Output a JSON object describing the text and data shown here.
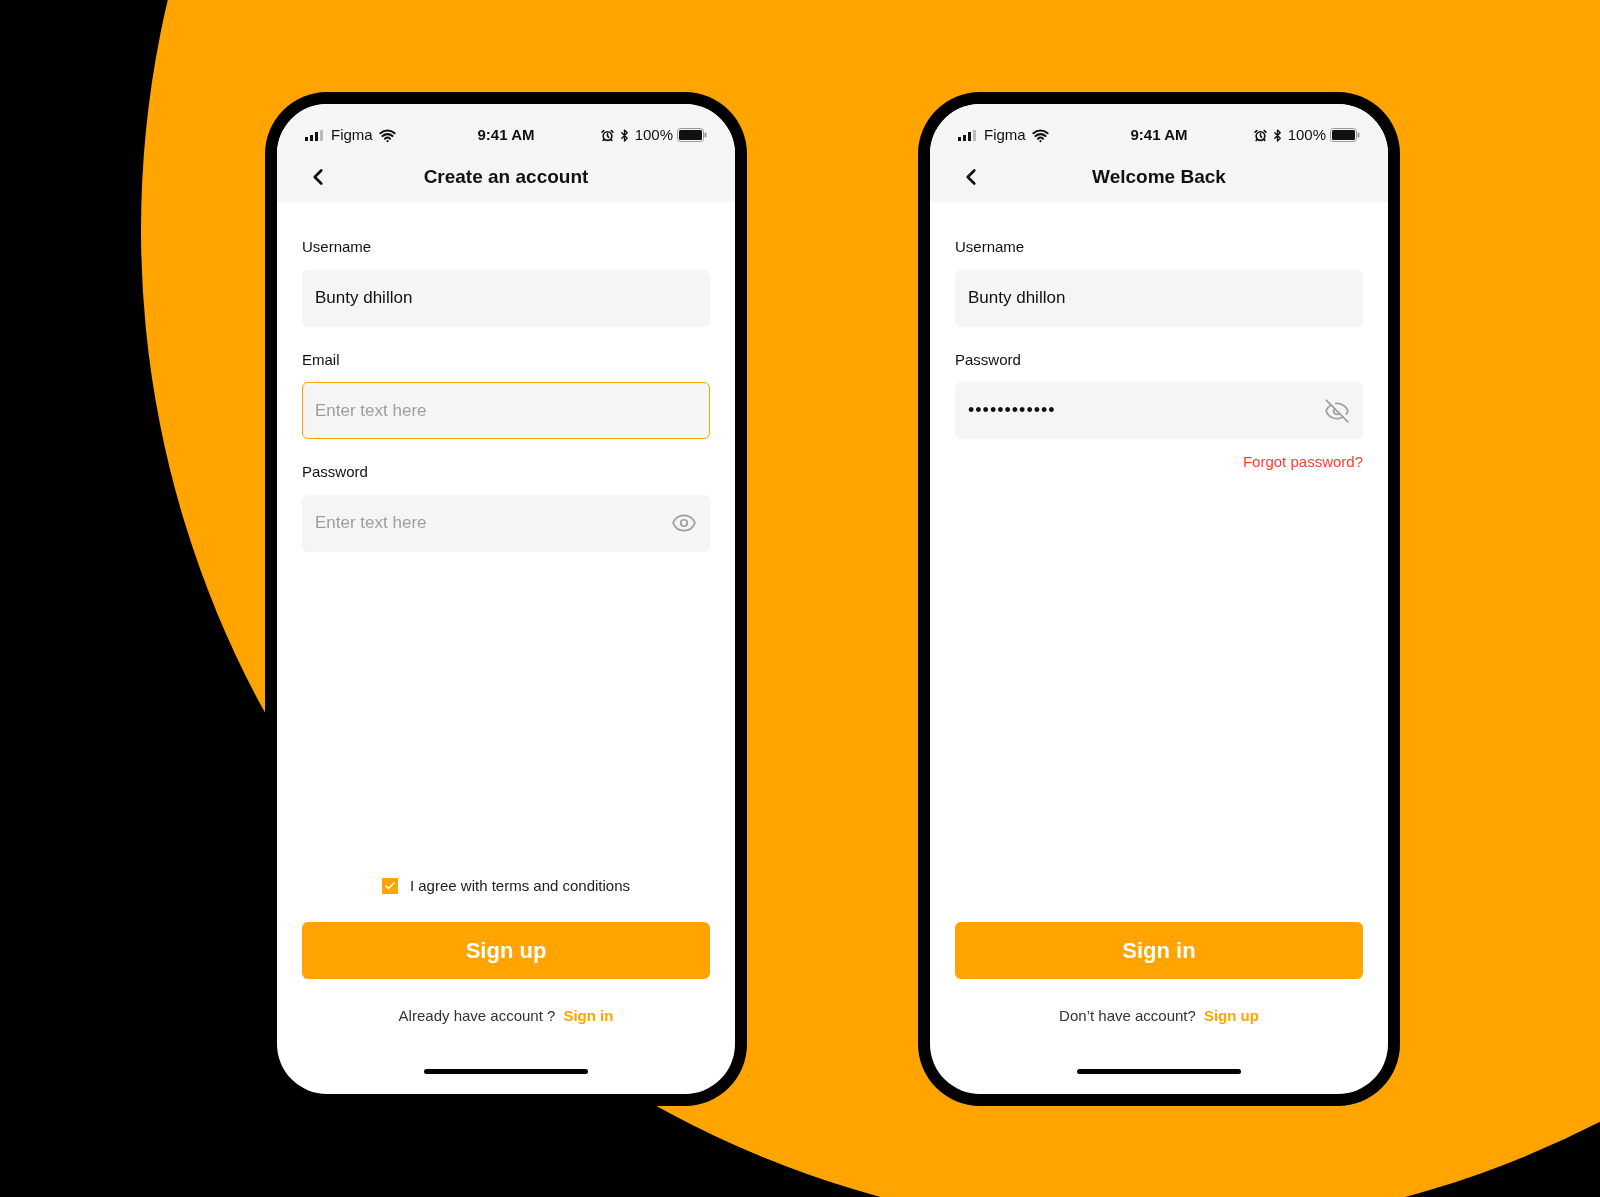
{
  "screens": [
    {
      "status_bar": {
        "carrier": "Figma",
        "time": "9:41 AM",
        "battery": "100%"
      },
      "title": "Create an account",
      "fields": [
        {
          "label": "Username",
          "value": "Bunty dhillon",
          "focused": false
        },
        {
          "label": "Email",
          "placeholder": "Enter text here",
          "focused": true
        },
        {
          "label": "Password",
          "placeholder": "Enter text here",
          "focused": false,
          "masked": false
        }
      ],
      "agree": {
        "label": "I agree with terms and conditions",
        "checked": true
      },
      "primary_button": "Sign up",
      "footer": {
        "text": "Already have account ?",
        "link": "Sign in"
      }
    },
    {
      "status_bar": {
        "carrier": "Figma",
        "time": "9:41 AM",
        "battery": "100%"
      },
      "title": "Welcome Back",
      "fields": [
        {
          "label": "Username",
          "value": "Bunty dhillon",
          "focused": false
        },
        {
          "label": "Password",
          "value": "••••••••••••",
          "focused": false,
          "masked": true
        }
      ],
      "forgot_link": "Forgot password?",
      "primary_button": "Sign in",
      "footer": {
        "text": "Don’t have account?",
        "link": "Sign up"
      }
    }
  ]
}
